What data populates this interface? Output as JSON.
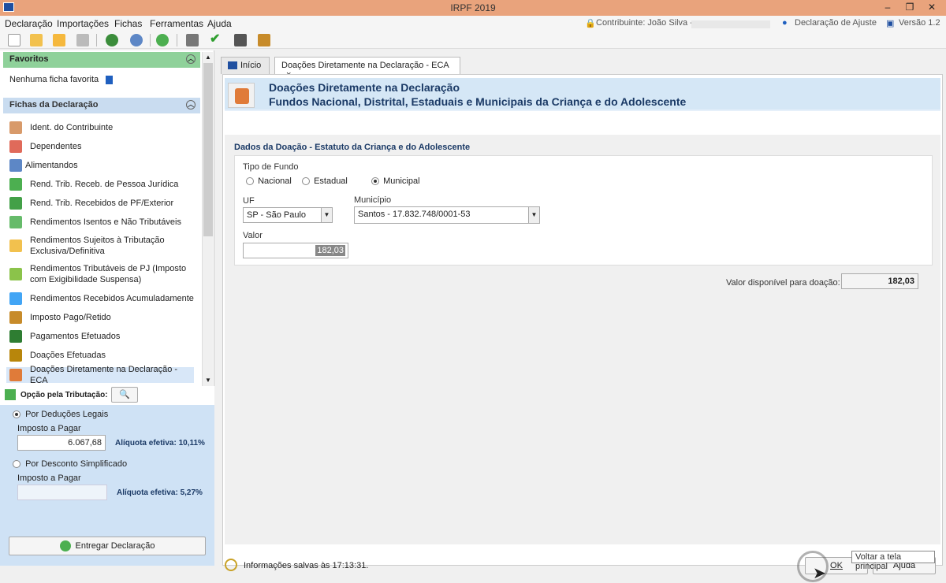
{
  "window": {
    "title": "IRPF 2019",
    "controls": [
      "–",
      "❐",
      "✕"
    ]
  },
  "menu": {
    "items": [
      "Declaração",
      "Importações",
      "Fichas",
      "Ferramentas",
      "Ajuda"
    ],
    "contribuinte": "Contribuinte: João Silva -",
    "declaracao": "Declaração de Ajuste",
    "versao": "Versão 1.2"
  },
  "sidebar": {
    "favoritos_title": "Favoritos",
    "favoritos_empty": "Nenhuma ficha favorita",
    "fichas_title": "Fichas da Declaração",
    "items": [
      {
        "label": "Ident. do Contribuinte",
        "color": "#d89a6a"
      },
      {
        "label": "Dependentes",
        "color": "#e06a5a"
      },
      {
        "label": "Alimentandos",
        "color": "#5d87c6"
      },
      {
        "label": "Rend. Trib. Receb. de Pessoa Jurídica",
        "color": "#4caf50"
      },
      {
        "label": "Rend. Trib. Recebidos de PF/Exterior",
        "color": "#43a047"
      },
      {
        "label": "Rendimentos Isentos e Não Tributáveis",
        "color": "#66bb6a"
      },
      {
        "label": "Rendimentos Sujeitos à Tributação Exclusiva/Definitiva",
        "color": "#f2c14e"
      },
      {
        "label": "Rendimentos Tributáveis de PJ (Imposto com Exigibilidade Suspensa)",
        "color": "#8bc34a"
      },
      {
        "label": "Rendimentos Recebidos Acumuladamente",
        "color": "#42a5f5"
      },
      {
        "label": "Imposto Pago/Retido",
        "color": "#c78b2a"
      },
      {
        "label": "Pagamentos Efetuados",
        "color": "#2e7d32"
      },
      {
        "label": "Doações Efetuadas",
        "color": "#b8860b"
      },
      {
        "label": "Doações Diretamente na Declaração - ECA",
        "color": "#e07b39"
      }
    ]
  },
  "tributacao": {
    "title": "Opção pela Tributação:",
    "deducoes_label": "Por Deduções Legais",
    "imposto_label_1": "Imposto a Pagar",
    "imposto_value_1": "6.067,68",
    "aliquota_1": "Alíquota efetiva: 10,11%",
    "simplificado_label": "Por Desconto Simplificado",
    "imposto_label_2": "Imposto a Pagar",
    "imposto_value_2": "",
    "aliquota_2": "Alíquota efetiva: 5,27%",
    "entregar": "Entregar Declaração"
  },
  "tabs": [
    {
      "label": "Início"
    },
    {
      "label": "Doações Diretamente na Declaração - ECA",
      "close": "×"
    }
  ],
  "banner": {
    "title": "Doações Diretamente na Declaração",
    "subtitle": "Fundos Nacional, Distrital, Estaduais e Municipais da Criança e do Adolescente"
  },
  "form": {
    "section": "Dados da Doação - Estatuto da Criança e do Adolescente",
    "tipo_fundo_label": "Tipo de Fundo",
    "options": [
      "Nacional",
      "Estadual",
      "Municipal"
    ],
    "selected": "Municipal",
    "uf_label": "UF",
    "uf_value": "SP - São Paulo",
    "municipio_label": "Município",
    "municipio_value": "Santos - 17.832.748/0001-53",
    "valor_label": "Valor",
    "valor_value": "182,03",
    "disponivel_label": "Valor disponível para doação:",
    "disponivel_value": "182,03"
  },
  "status": {
    "saved": "Informações salvas às 17:13:31.",
    "ok": "OK",
    "ajuda": "Ajuda",
    "tooltip": "Voltar a tela principal"
  }
}
